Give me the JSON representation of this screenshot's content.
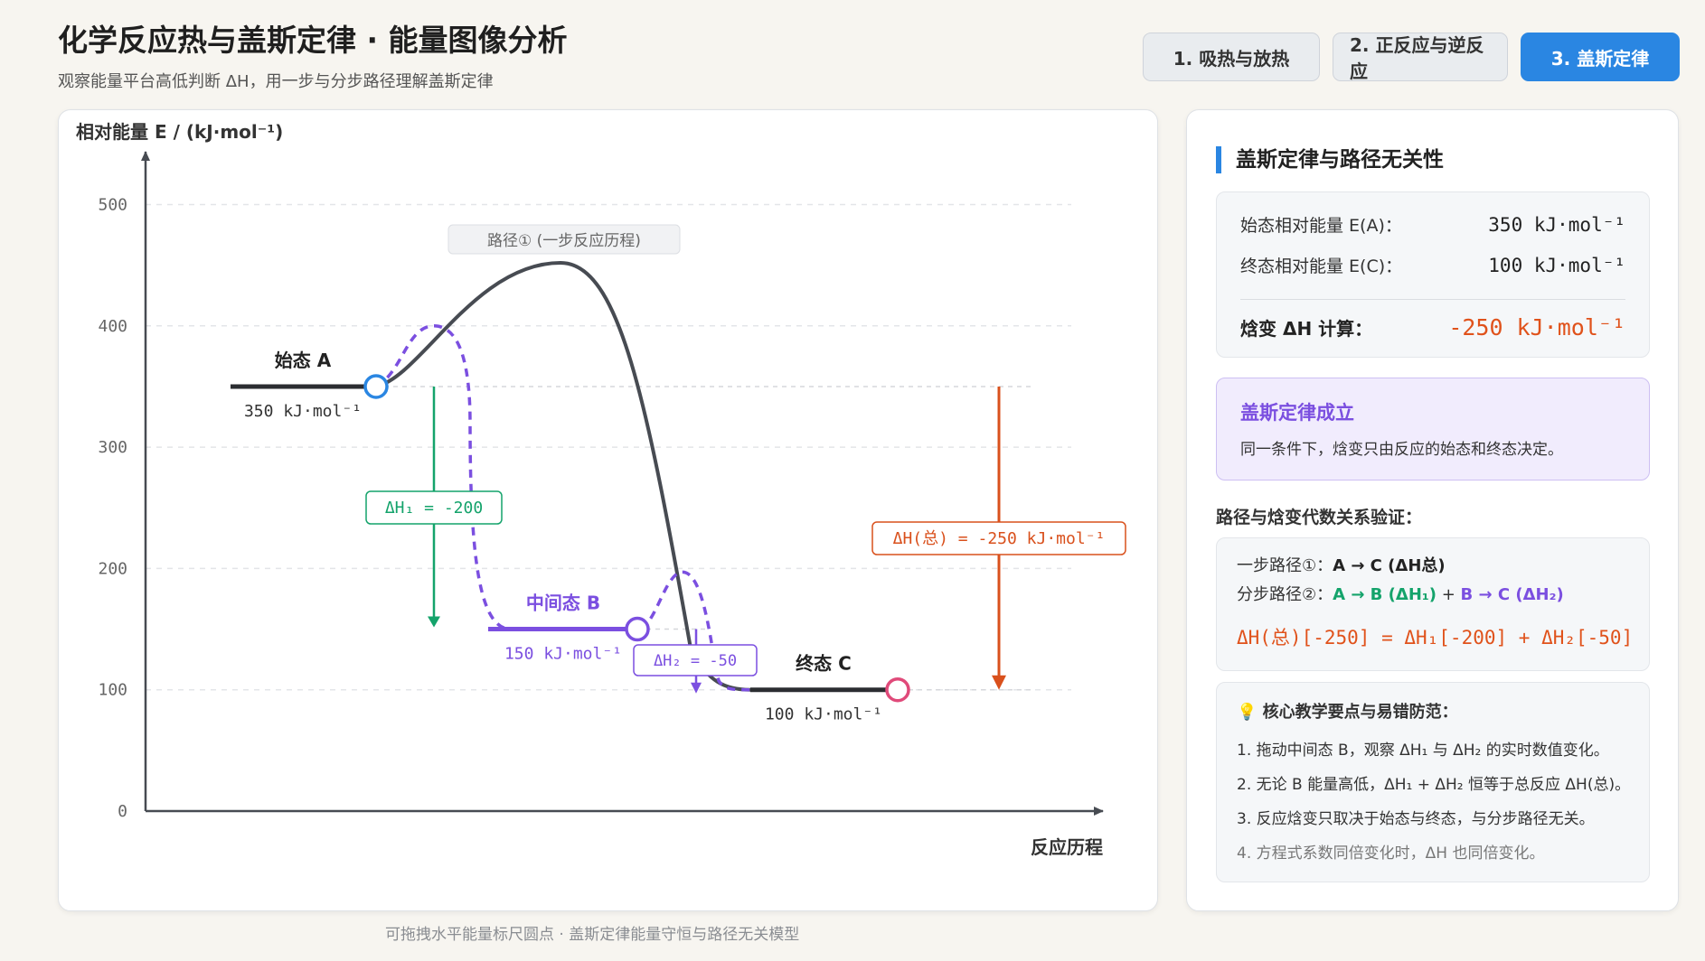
{
  "header": {
    "title": "化学反应热与盖斯定律 · 能量图像分析",
    "subtitle": "观察能量平台高低判断 ΔH，用一步与分步路径理解盖斯定律"
  },
  "tabs": [
    {
      "label": "1. 吸热与放热",
      "active": false
    },
    {
      "label": "2. 正反应与逆反应",
      "active": false
    },
    {
      "label": "3. 盖斯定律",
      "active": true
    }
  ],
  "chart_data": {
    "type": "line",
    "ylabel": "相对能量 E / (kJ·mol⁻¹)",
    "xlabel": "反应历程",
    "ylim": [
      0,
      500
    ],
    "yticks": [
      0,
      100,
      200,
      300,
      400,
      500
    ],
    "path_label": "路径① (一步反应历程)",
    "levels": {
      "A": {
        "label": "始态 A",
        "energy": 350,
        "energy_text": "350 kJ·mol⁻¹"
      },
      "B": {
        "label": "中间态 B",
        "energy": 150,
        "energy_text": "150 kJ·mol⁻¹"
      },
      "C": {
        "label": "终态 C",
        "energy": 100,
        "energy_text": "100 kJ·mol⁻¹"
      }
    },
    "one_step_peak": 452,
    "step1_peak": 400,
    "step2_peak": 197,
    "dh1_label": "ΔH₁ = -200",
    "dh2_label": "ΔH₂ = -50",
    "dh_total_label": "ΔH(总) = -250 kJ·mol⁻¹",
    "colors": {
      "one_step": "#474b52",
      "stepwise": "#7b4fe0",
      "dh1": "#14a36b",
      "dh2": "#7b4fe0",
      "total": "#d9501c",
      "handle_a": "#2a86e2",
      "handle_c": "#e04a7a"
    }
  },
  "info": {
    "title": "盖斯定律与路径无关性",
    "ea_label": "始态相对能量 E(A)：",
    "ea_value": "350 kJ·mol⁻¹",
    "ec_label": "终态相对能量 E(C)：",
    "ec_value": "100 kJ·mol⁻¹",
    "dh_label": "焓变 ΔH 计算：",
    "dh_value": "-250 kJ·mol⁻¹",
    "law_title": "盖斯定律成立",
    "law_desc": "同一条件下，焓变只由反应的始态和终态决定。",
    "verify_heading": "路径与焓变代数关系验证：",
    "one_step_prefix": "一步路径①：",
    "one_step_expr": "A → C (ΔH总)",
    "multi_step_prefix": "分步路径②：",
    "multi_step_part1": "A → B (ΔH₁)",
    "multi_step_plus": " + ",
    "multi_step_part2": "B → C (ΔH₂)",
    "equation": "ΔH(总)[-250] = ΔH₁[-200] + ΔH₂[-50]",
    "tips_title": "💡 核心教学要点与易错防范：",
    "tips": [
      "1. 拖动中间态 B，观察 ΔH₁ 与 ΔH₂ 的实时数值变化。",
      "2. 无论 B 能量高低，ΔH₁ + ΔH₂ 恒等于总反应 ΔH(总)。",
      "3. 反应焓变只取决于始态与终态，与分步路径无关。",
      "4. 方程式系数同倍变化时，ΔH 也同倍变化。"
    ]
  },
  "footer": "可拖拽水平能量标尺圆点 · 盖斯定律能量守恒与路径无关模型"
}
